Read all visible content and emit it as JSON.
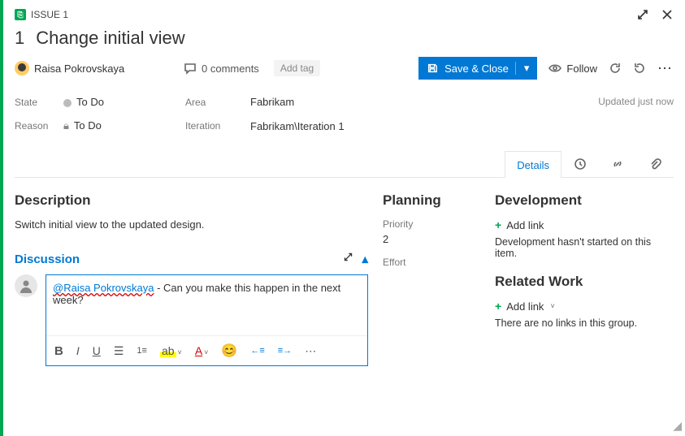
{
  "header": {
    "issue_label": "ISSUE 1",
    "id": "1",
    "title": "Change initial view"
  },
  "meta": {
    "assignee": "Raisa Pokrovskaya",
    "comments_label": "0 comments",
    "add_tag_label": "Add tag",
    "save_label": "Save & Close",
    "follow_label": "Follow",
    "updated_label": "Updated just now"
  },
  "fields": {
    "state_label": "State",
    "state_value": "To Do",
    "reason_label": "Reason",
    "reason_value": "To Do",
    "area_label": "Area",
    "area_value": "Fabrikam",
    "iteration_label": "Iteration",
    "iteration_value": "Fabrikam\\Iteration 1"
  },
  "tabs": {
    "details": "Details"
  },
  "description": {
    "heading": "Description",
    "body": "Switch initial view to the updated design."
  },
  "discussion": {
    "heading": "Discussion",
    "mention": "@Raisa Pokrovskaya",
    "text": " - Can you make this happen in the next week?"
  },
  "planning": {
    "heading": "Planning",
    "priority_label": "Priority",
    "priority_value": "2",
    "effort_label": "Effort"
  },
  "development": {
    "heading": "Development",
    "add_link": "Add link",
    "helper": "Development hasn't started on this item."
  },
  "related": {
    "heading": "Related Work",
    "add_link": "Add link",
    "helper": "There are no links in this group."
  }
}
